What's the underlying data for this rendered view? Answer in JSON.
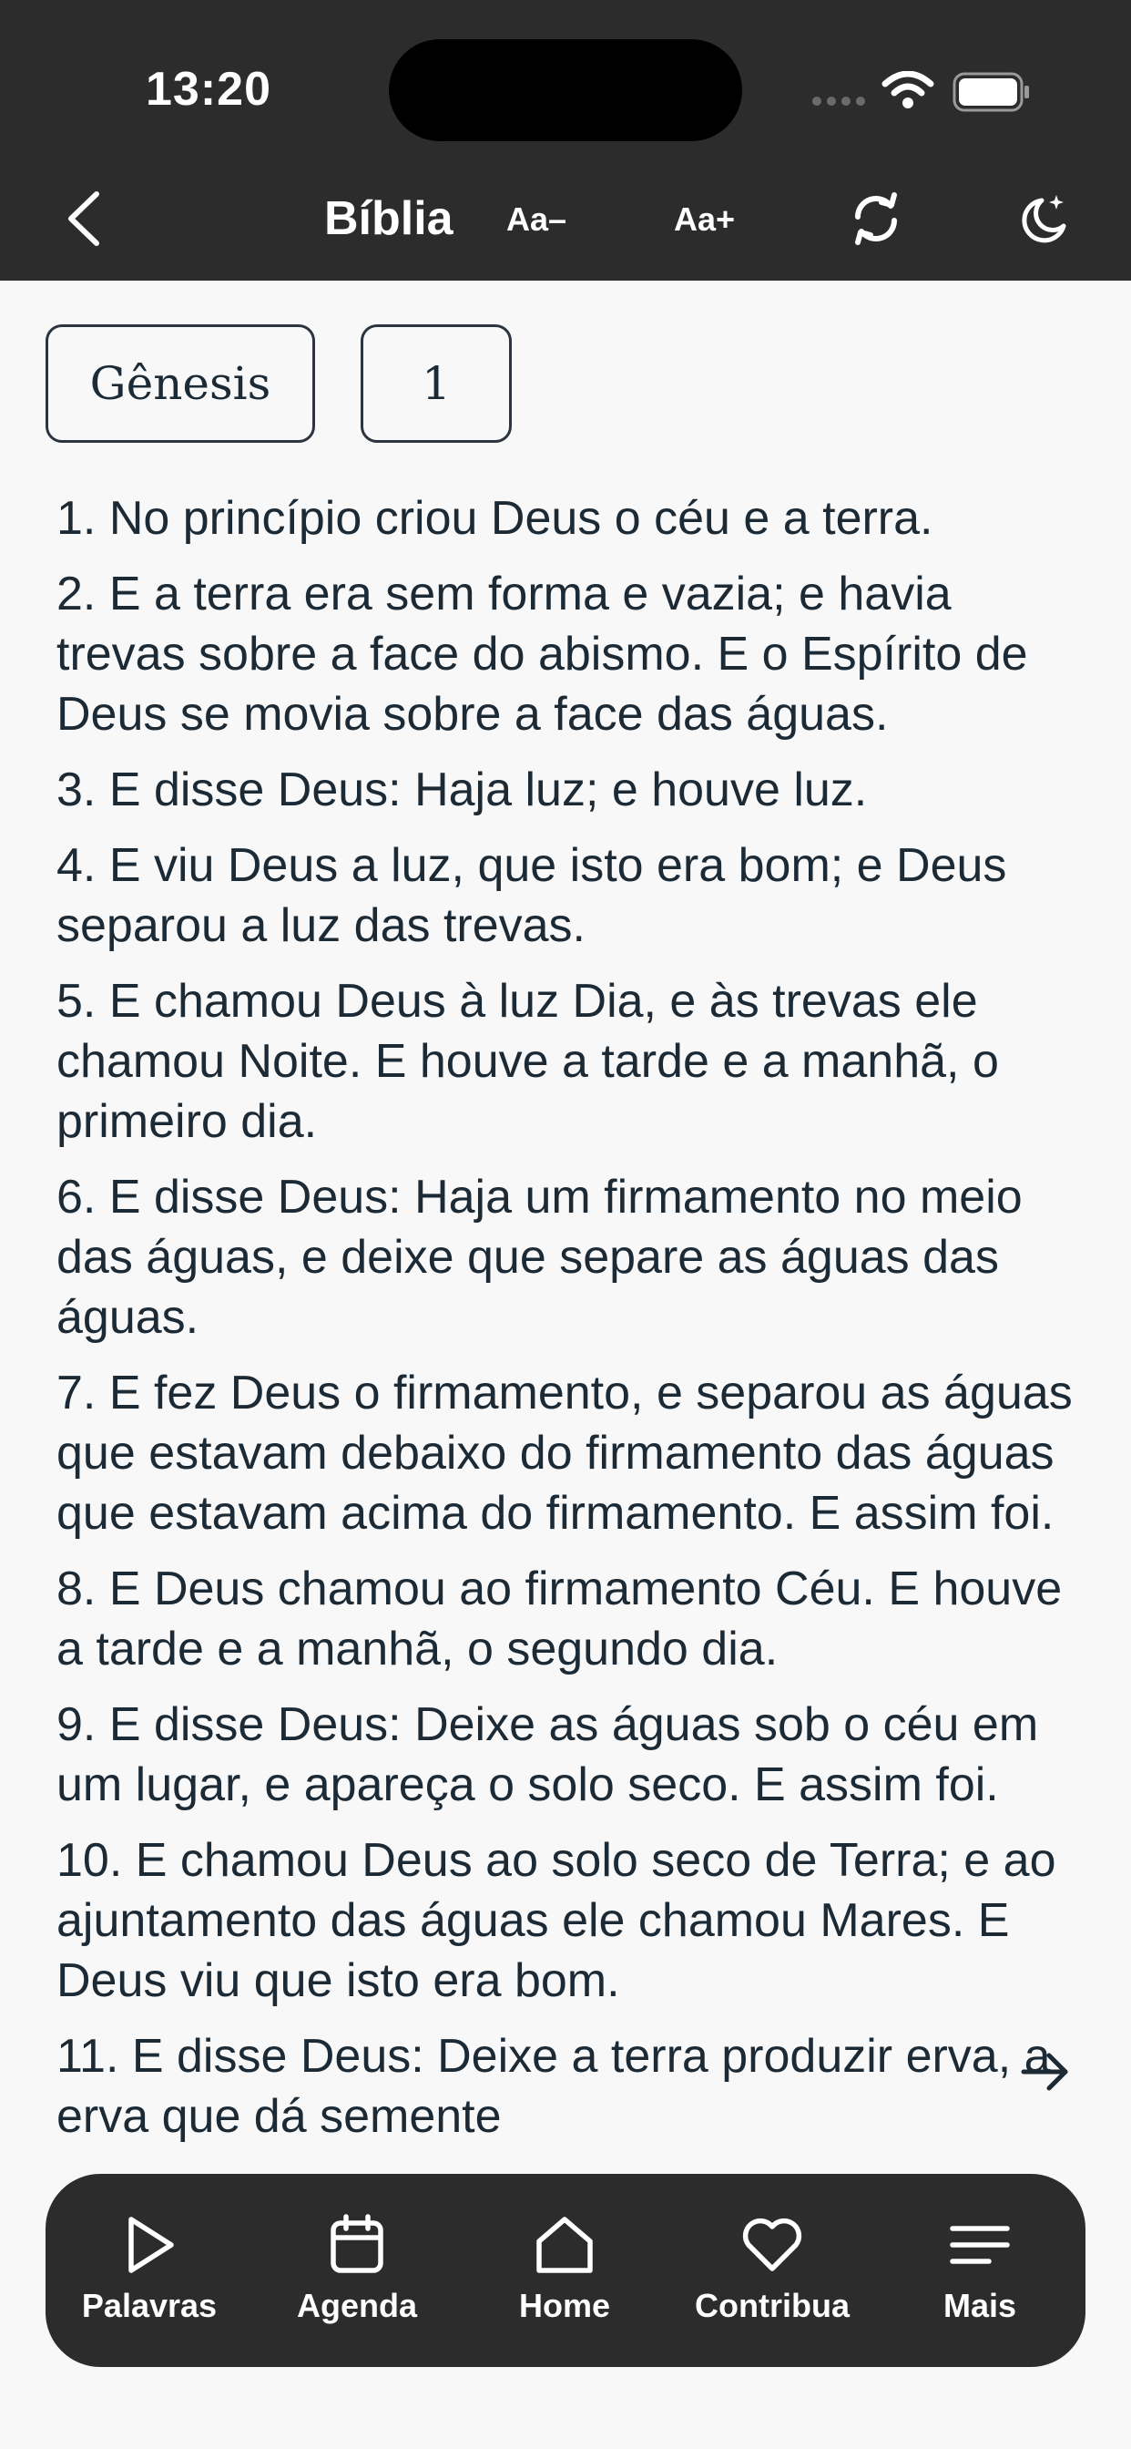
{
  "status_bar": {
    "time": "13:20"
  },
  "header": {
    "title": "Bíblia",
    "font_decrease_label": "Aa–",
    "font_increase_label": "Aa+"
  },
  "selectors": {
    "book": "Gênesis",
    "chapter": "1"
  },
  "verses": [
    "1. No princípio criou Deus o céu e a terra.",
    "2. E a terra era sem forma e vazia; e havia trevas sobre a face do abismo. E o Espírito de Deus se movia sobre a face das águas.",
    "3. E disse Deus: Haja luz; e houve luz.",
    "4. E viu Deus a luz, que isto era bom; e Deus separou a luz das trevas.",
    "5. E chamou Deus à luz Dia, e às trevas ele chamou Noite. E houve a tarde e a manhã, o primeiro dia.",
    "6. E disse Deus: Haja um firmamento no meio das águas, e deixe que separe as águas das águas.",
    "7. E fez Deus o firmamento, e separou as águas que estavam debaixo do firmamento das águas que estavam acima do firmamento. E assim foi.",
    "8. E Deus chamou ao firmamento Céu. E houve a tarde e a manhã, o segundo dia.",
    "9. E disse Deus: Deixe as águas sob o céu em um lugar, e apareça o solo seco. E assim foi.",
    "10. E chamou Deus ao solo seco de Terra; e ao ajuntamento das águas ele chamou Mares. E Deus viu que isto era bom.",
    "11. E disse Deus: Deixe a terra produzir erva, a erva que dá semente"
  ],
  "tabbar": {
    "items": [
      {
        "label": "Palavras",
        "icon": "play-icon"
      },
      {
        "label": "Agenda",
        "icon": "calendar-icon"
      },
      {
        "label": "Home",
        "icon": "home-icon"
      },
      {
        "label": "Contribua",
        "icon": "heart-icon"
      },
      {
        "label": "Mais",
        "icon": "menu-icon"
      }
    ]
  },
  "colors": {
    "bar_background": "#2c2c2c",
    "page_background": "#f8f8f8",
    "text": "#1c2a36"
  }
}
